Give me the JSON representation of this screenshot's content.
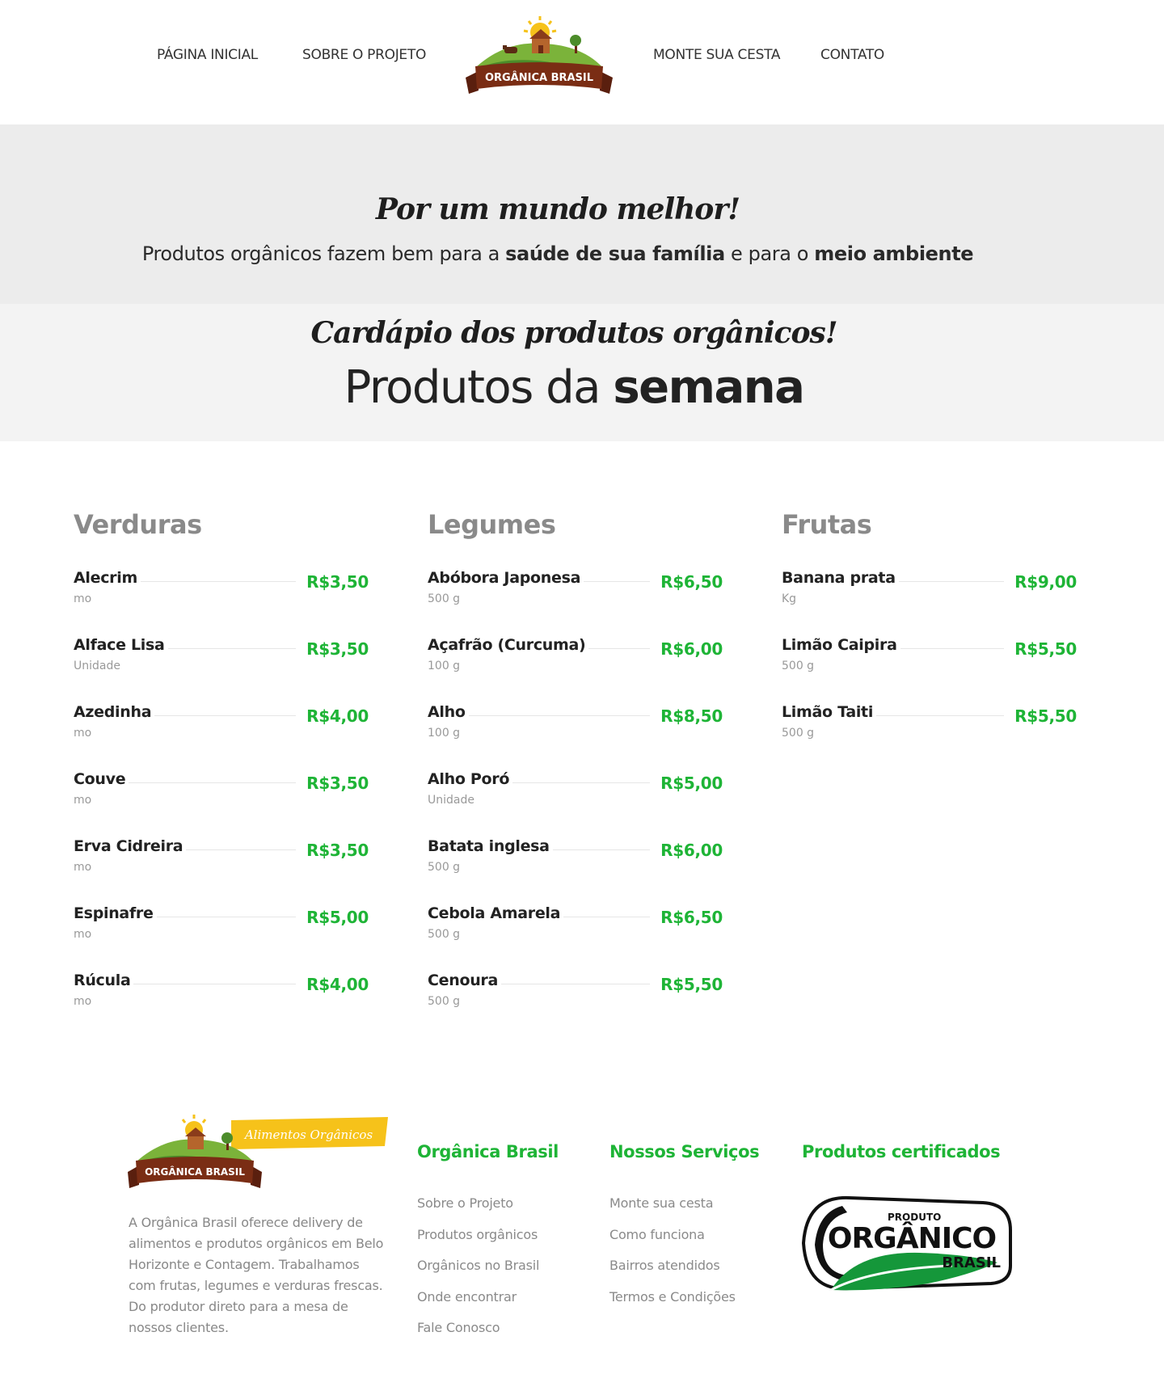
{
  "header": {
    "nav": [
      "PÁGINA INICIAL",
      "SOBRE O PROJETO",
      "MONTE SUA CESTA",
      "CONTATO"
    ],
    "logo_text": "ORGÂNICA BRASIL"
  },
  "hero": {
    "script_title": "Por um mundo melhor!",
    "subtitle_part1": "Produtos orgânicos fazem bem para a ",
    "subtitle_bold1": "saúde de sua família",
    "subtitle_part2": " e para o ",
    "subtitle_bold2": "meio ambiente"
  },
  "menu": {
    "script_title": "Cardápio dos produtos orgânicos!",
    "title_normal": "Produtos da ",
    "title_bold": "semana"
  },
  "columns": [
    {
      "title": "Verduras",
      "items": [
        {
          "name": "Alecrim",
          "unit": "mo",
          "price": "R$3,50"
        },
        {
          "name": "Alface Lisa",
          "unit": "Unidade",
          "price": "R$3,50"
        },
        {
          "name": "Azedinha",
          "unit": "mo",
          "price": "R$4,00"
        },
        {
          "name": "Couve",
          "unit": "mo",
          "price": "R$3,50"
        },
        {
          "name": "Erva Cidreira",
          "unit": "mo",
          "price": "R$3,50"
        },
        {
          "name": "Espinafre",
          "unit": "mo",
          "price": "R$5,00"
        },
        {
          "name": "Rúcula",
          "unit": "mo",
          "price": "R$4,00"
        }
      ]
    },
    {
      "title": "Legumes",
      "items": [
        {
          "name": "Abóbora Japonesa",
          "unit": "500 g",
          "price": "R$6,50"
        },
        {
          "name": "Açafrão (Curcuma)",
          "unit": "100 g",
          "price": "R$6,00"
        },
        {
          "name": "Alho",
          "unit": "100 g",
          "price": "R$8,50"
        },
        {
          "name": "Alho Poró",
          "unit": "Unidade",
          "price": "R$5,00"
        },
        {
          "name": "Batata inglesa",
          "unit": "500 g",
          "price": "R$6,00"
        },
        {
          "name": "Cebola Amarela",
          "unit": "500 g",
          "price": "R$6,50"
        },
        {
          "name": "Cenoura",
          "unit": "500 g",
          "price": "R$5,50"
        }
      ]
    },
    {
      "title": "Frutas",
      "items": [
        {
          "name": "Banana prata",
          "unit": "Kg",
          "price": "R$9,00"
        },
        {
          "name": "Limão Caipira",
          "unit": "500 g",
          "price": "R$5,50"
        },
        {
          "name": "Limão Taiti",
          "unit": "500 g",
          "price": "R$5,50"
        }
      ]
    }
  ],
  "footer": {
    "logo_text": "ORGÂNICA BRASIL",
    "logo_tag": "Alimentos Orgânicos",
    "about": "A Orgânica Brasil oferece delivery de alimentos e produtos orgânicos em Belo Horizonte e Contagem. Trabalhamos com frutas, legumes e verduras frescas. Do produtor direto para a mesa de nossos clientes.",
    "columns": [
      {
        "title": "Orgânica Brasil",
        "links": [
          "Sobre o Projeto",
          "Produtos orgânicos",
          "Orgânicos no Brasil",
          "Onde encontrar",
          "Fale Conosco"
        ]
      },
      {
        "title": "Nossos Serviços",
        "links": [
          "Monte sua cesta",
          "Como funciona",
          "Bairros atendidos",
          "Termos e Condições"
        ]
      },
      {
        "title": "Produtos certificados",
        "links": []
      }
    ],
    "cert": {
      "top": "PRODUTO",
      "main": "ORGÂNICO",
      "bottom": "BRASIL"
    }
  },
  "colors": {
    "accent_green": "#1eb436",
    "hero_bg": "#ececec",
    "menu_bg": "#f3f3f3",
    "logo_brown": "#6b2a14"
  }
}
